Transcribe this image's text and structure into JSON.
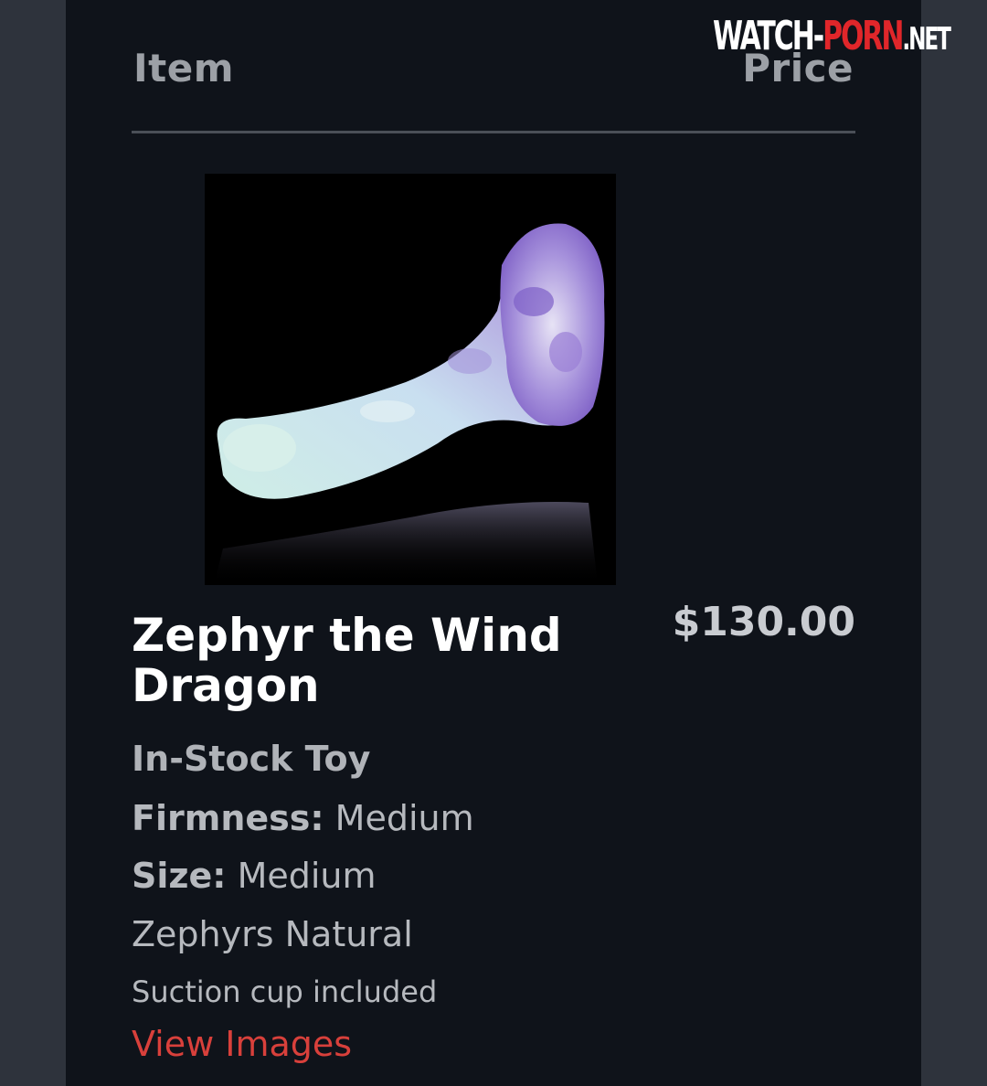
{
  "header": {
    "item_label": "Item",
    "price_label": "Price"
  },
  "watermark": {
    "part1": "WATCH-",
    "part2": "PORN",
    "part3": ".NET"
  },
  "product": {
    "name": "Zephyr the Wind Dragon",
    "price": "$130.00",
    "stock_status": "In-Stock Toy",
    "firmness_label": "Firmness:",
    "firmness_value": " Medium",
    "size_label": "Size:",
    "size_value": " Medium",
    "color_variant": "Zephyrs Natural",
    "extra": "Suction cup included",
    "view_images_link": "View Images"
  },
  "colors": {
    "background": "#0f131a",
    "link": "#d8403b",
    "accent_purple": "#8d6fd1",
    "accent_mint": "#bfe8dc"
  }
}
